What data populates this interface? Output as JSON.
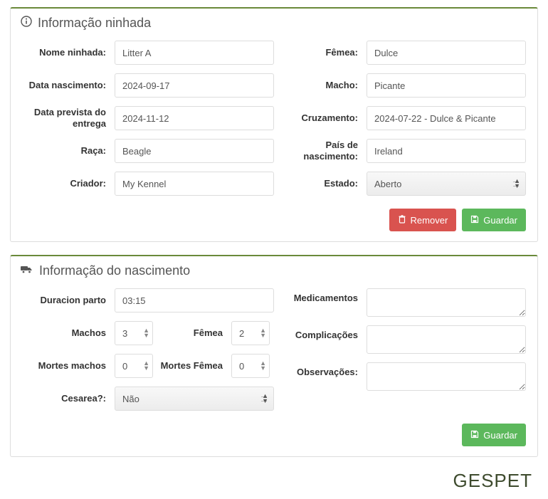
{
  "panel1": {
    "title": "Informação ninhada",
    "labels": {
      "nome": "Nome ninhada:",
      "dataNasc": "Data nascimento:",
      "dataPrev": "Data prevista do entrega",
      "raca": "Raça:",
      "criador": "Criador:",
      "femea": "Fêmea:",
      "macho": "Macho:",
      "cruz": "Cruzamento:",
      "pais": "País de nascimento:",
      "estado": "Estado:"
    },
    "values": {
      "nome": "Litter A",
      "dataNasc": "2024-09-17",
      "dataPrev": "2024-11-12",
      "raca": "Beagle",
      "criador": "My Kennel",
      "femea": "Dulce",
      "macho": "Picante",
      "cruz": "2024-07-22 - Dulce & Picante",
      "pais": "Ireland",
      "estado": "Aberto"
    },
    "buttons": {
      "remover": "Remover",
      "guardar": "Guardar"
    }
  },
  "panel2": {
    "title": "Informação do nascimento",
    "labels": {
      "dur": "Duracion parto",
      "machos": "Machos",
      "femea": "Fêmea",
      "mortesM": "Mortes machos",
      "mortesF": "Mortes Fêmea",
      "cesarea": "Cesarea?:",
      "med": "Medicamentos",
      "compl": "Complicações",
      "obs": "Observações:"
    },
    "values": {
      "dur": "03:15",
      "machos": "3",
      "femea": "2",
      "mortesM": "0",
      "mortesF": "0",
      "cesarea": "Não",
      "med": "",
      "compl": "",
      "obs": ""
    },
    "buttons": {
      "guardar": "Guardar"
    }
  },
  "brand": "GESPET"
}
